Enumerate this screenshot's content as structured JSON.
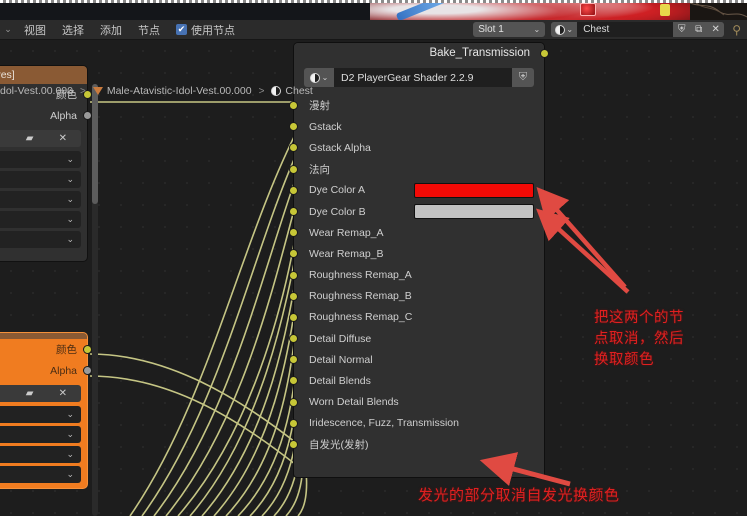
{
  "app": {
    "editor": "Shader Editor"
  },
  "menubar": {
    "collapse_icon": "chevron-down",
    "items": [
      "视图",
      "选择",
      "添加",
      "节点"
    ],
    "use_nodes": {
      "label": "使用节点",
      "checked": true,
      "check_glyph": "✔"
    },
    "slot": {
      "value": "Slot 1",
      "caret": "⌄"
    },
    "material": {
      "browse_icon": "material-sphere",
      "name": "Chest",
      "buttons": [
        "shield",
        "copy",
        "close"
      ],
      "shield_glyph": "⛨",
      "copy_glyph": "⧉",
      "close_glyph": "✕",
      "pin_glyph": "⚲"
    }
  },
  "breadcrumb": {
    "items": [
      {
        "label": "dol-Vest.00.000",
        "icon": "none"
      },
      {
        "label": "Male-Atavistic-Idol-Vest.00.000",
        "icon": "mesh-data-icon"
      },
      {
        "label": "Chest",
        "icon": "material-sphere-icon"
      }
    ],
    "separator": ">"
  },
  "left_nodes": {
    "top": {
      "title": "hives textures]",
      "outputs": [
        {
          "label": "颜色",
          "color": "yellow"
        },
        {
          "label": "Alpha",
          "color": "gray"
        }
      ],
      "toolbar_icons": [
        "shield",
        "copy",
        "folder",
        "close"
      ],
      "toolbar_glyphs": [
        "⛨",
        "⧉",
        "▰",
        "✕"
      ],
      "dropdown_rows": 5,
      "dropdown_caret": "⌄"
    },
    "bottom": {
      "title": "",
      "selected": true,
      "outputs": [
        {
          "label": "颜色",
          "color": "yellow"
        },
        {
          "label": "Alpha",
          "color": "gray"
        }
      ],
      "toolbar_icons": [
        "shield",
        "copy",
        "folder",
        "close"
      ],
      "toolbar_glyphs": [
        "⛨",
        "⧉",
        "▰",
        "✕"
      ],
      "dropdown_rows": 4,
      "dropdown_caret": "⌄"
    }
  },
  "main_node": {
    "title": "Bake_Transmission",
    "shader": {
      "name": "D2 PlayerGear Shader 2.2.9",
      "browse_glyph": "⬤",
      "caret": "⌄",
      "shield_glyph": "⛨"
    },
    "inputs": [
      {
        "label": "漫射",
        "type": "socket"
      },
      {
        "label": "Gstack",
        "type": "socket"
      },
      {
        "label": "Gstack Alpha",
        "type": "socket"
      },
      {
        "label": "法向",
        "type": "socket"
      },
      {
        "label": "Dye Color A",
        "type": "color",
        "value": "#F40A06"
      },
      {
        "label": "Dye Color B",
        "type": "color",
        "value": "#C2C2C2"
      },
      {
        "label": "Wear Remap_A",
        "type": "socket"
      },
      {
        "label": "Wear Remap_B",
        "type": "socket"
      },
      {
        "label": "Roughness Remap_A",
        "type": "socket"
      },
      {
        "label": "Roughness Remap_B",
        "type": "socket"
      },
      {
        "label": "Roughness Remap_C",
        "type": "socket"
      },
      {
        "label": "Detail Diffuse",
        "type": "socket"
      },
      {
        "label": "Detail Normal",
        "type": "socket"
      },
      {
        "label": "Detail Blends",
        "type": "socket"
      },
      {
        "label": "Worn Detail Blends",
        "type": "socket"
      },
      {
        "label": "Iridescence, Fuzz, Transmission",
        "type": "socket"
      },
      {
        "label": "自发光(发射)",
        "type": "socket"
      }
    ]
  },
  "annotations": {
    "right_note": "把这两个的节\n点取消，然后\n换取颜色",
    "bottom_note": "发光的部分取消自发光换颜色",
    "arrow_count": 3,
    "color": "#E02020"
  },
  "colors": {
    "canvas_bg": "#1d1d1d",
    "node_bg": "#303030",
    "node_header_left": "#8a5a34",
    "selected_node": "#f07c20",
    "socket_yellow": "#c7c737",
    "socket_gray": "#9a9a9a",
    "noodle": "#cfcf8a",
    "accent_blue": "#4772b3",
    "annotation_red": "#E02020"
  }
}
